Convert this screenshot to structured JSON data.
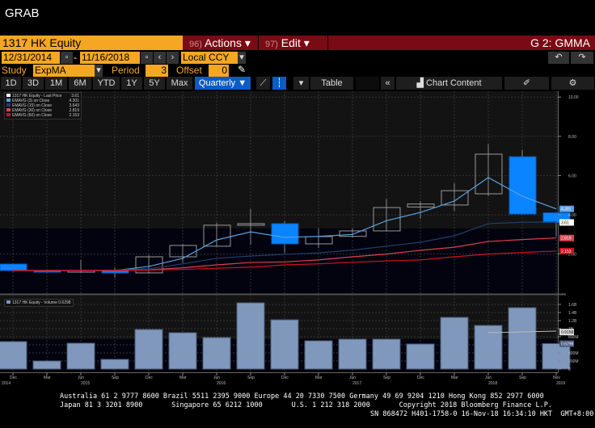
{
  "app_title": "GRAB",
  "header": {
    "ticker": "1317 HK Equity",
    "actions": "Actions",
    "actions_num": "96)",
    "edit": "Edit",
    "edit_num": "97)",
    "function": "G 2: GMMA"
  },
  "dates": {
    "start": "12/31/2014",
    "sep": "-",
    "end": "11/16/2018",
    "currency": "Local CCY"
  },
  "study": {
    "label": "Study",
    "value": "ExpMA",
    "period_label": "Period",
    "period": "3",
    "offset_label": "Offset",
    "offset": "0"
  },
  "toolbar": {
    "ranges": [
      "1D",
      "3D",
      "1M",
      "6M",
      "YTD",
      "1Y",
      "5Y",
      "Max"
    ],
    "frequency": "Quarterly ▼",
    "table": "Table",
    "chart_content": "Chart Content"
  },
  "legend": [
    {
      "label": "1317 HK Equity - Last Price",
      "value": "3.61",
      "color": "#ffffff"
    },
    {
      "label": "EMAVG (3) on Close",
      "value": "4.301",
      "color": "#5aa0e0"
    },
    {
      "label": "EMAVG (15) on Close",
      "value": "3.643",
      "color": "#1f3f6a"
    },
    {
      "label": "EMAVG (30) on Close",
      "value": "2.819",
      "color": "#e04050"
    },
    {
      "label": "EMAVG (60) on Close",
      "value": "2.153",
      "color": "#d01020"
    }
  ],
  "volume_legend": {
    "label": "1317 HK Equity - Volume",
    "value": "0.6298"
  },
  "chart_data": {
    "type": "candlestick",
    "categories": [
      "Dec 2014",
      "Mar 2015",
      "Jun 2015",
      "Sep 2015",
      "Dec 2015",
      "Mar 2016",
      "Jun 2016",
      "Sep 2016",
      "Dec 2016",
      "Mar 2017",
      "Jun 2017",
      "Sep 2017",
      "Dec 2017",
      "Mar 2018",
      "Jun 2018",
      "Sep 2018",
      "Nov 2018"
    ],
    "open": [
      1.49,
      1.16,
      1.1,
      1.16,
      1.04,
      1.86,
      2.4,
      3.47,
      3.55,
      2.52,
      2.9,
      3.18,
      4.4,
      4.5,
      5.07,
      6.96,
      4.1
    ],
    "close": [
      1.16,
      1.1,
      1.16,
      1.04,
      1.86,
      2.44,
      3.47,
      3.55,
      2.52,
      2.89,
      3.18,
      4.37,
      4.55,
      5.23,
      7.09,
      4.04,
      3.61
    ],
    "high": [
      1.5,
      1.2,
      1.7,
      1.3,
      1.95,
      2.5,
      3.6,
      4.29,
      3.67,
      3.3,
      3.3,
      4.8,
      4.7,
      5.6,
      7.6,
      7.3,
      4.1
    ],
    "low": [
      1.1,
      1.05,
      1.05,
      0.8,
      1.0,
      1.55,
      2.4,
      2.48,
      2.06,
      2.3,
      2.85,
      3.15,
      3.8,
      4.2,
      4.95,
      4.0,
      2.9
    ],
    "ema": [
      {
        "name": "EMAVG (3)",
        "values": [
          1.16,
          1.16,
          1.16,
          1.16,
          1.37,
          1.78,
          2.72,
          3.13,
          2.85,
          2.9,
          3.0,
          3.7,
          4.12,
          4.7,
          5.9,
          4.95,
          4.3
        ]
      },
      {
        "name": "EMAVG (15)",
        "values": [
          1.16,
          1.16,
          1.17,
          1.18,
          1.25,
          1.5,
          1.78,
          1.9,
          1.98,
          2.06,
          2.2,
          2.4,
          2.6,
          2.93,
          3.55,
          3.62,
          3.64
        ]
      },
      {
        "name": "EMAVG (30)",
        "values": [
          1.16,
          1.16,
          1.16,
          1.17,
          1.2,
          1.3,
          1.45,
          1.57,
          1.6,
          1.7,
          1.86,
          2.0,
          2.19,
          2.35,
          2.64,
          2.74,
          2.82
        ]
      },
      {
        "name": "EMAVG (60)",
        "values": [
          1.16,
          1.16,
          1.16,
          1.16,
          1.18,
          1.22,
          1.28,
          1.33,
          1.45,
          1.5,
          1.58,
          1.65,
          1.7,
          1.86,
          2.0,
          2.08,
          2.15
        ]
      }
    ],
    "price_ticks": [
      "2.00",
      "4.00",
      "6.00",
      "8.00",
      "10.00"
    ],
    "price_labels": [
      "4.301",
      "3.61",
      "2.819",
      "2.153"
    ],
    "volume_B": [
      0.68,
      0.2,
      0.64,
      0.24,
      0.98,
      0.9,
      0.78,
      1.64,
      1.22,
      0.7,
      0.74,
      0.74,
      0.62,
      1.28,
      1.08,
      1.52,
      0.63
    ],
    "volume_ticks": [
      "0",
      "200M",
      "400M",
      "800M",
      "1B",
      "1.2B",
      "1.4B",
      "1.6B"
    ],
    "volume_labels": [
      "0.9158",
      "0.6298"
    ],
    "x_months": [
      "Dec",
      "Mar",
      "Jun",
      "Sep",
      "Dec",
      "Mar",
      "Jun",
      "Sep",
      "Dec",
      "Mar",
      "Jun",
      "Sep",
      "Dec",
      "Mar",
      "Jun",
      "Sep",
      "Nov"
    ],
    "x_years": [
      "2014",
      "2015",
      "2016",
      "2017",
      "2018",
      "2019"
    ]
  },
  "footer": {
    "line1": "Australia 61 2 9777 8600 Brazil 5511 2395 9000 Europe 44 20 7330 7500 Germany 49 69 9204 1210 Hong Kong 852 2977 6000",
    "line2": "Japan 81 3 3201 8900       Singapore 65 6212 1000       U.S. 1 212 318 2000       Copyright 2018 Bloomberg Finance L.P.",
    "line3": "SN 868472 H401-1758-0 16-Nov-18 16:34:10 HKT  GMT+8:00"
  }
}
